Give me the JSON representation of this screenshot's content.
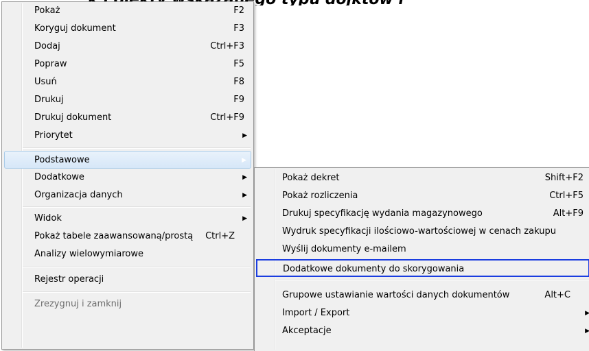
{
  "header_fragment": "k i ojekty wskazanego typu dojktow i",
  "main_menu": {
    "items": [
      {
        "label": "Pokaż",
        "shortcut": "F2"
      },
      {
        "label": "Koryguj dokument",
        "shortcut": "F3"
      },
      {
        "label": "Dodaj",
        "shortcut": "Ctrl+F3"
      },
      {
        "label": "Popraw",
        "shortcut": "F5"
      },
      {
        "label": "Usuń",
        "shortcut": "F8"
      },
      {
        "label": "Drukuj",
        "shortcut": "F9"
      },
      {
        "label": "Drukuj dokument",
        "shortcut": "Ctrl+F9"
      },
      {
        "label": "Priorytet",
        "shortcut": ""
      },
      {
        "label": "Podstawowe",
        "shortcut": ""
      },
      {
        "label": "Dodatkowe",
        "shortcut": ""
      },
      {
        "label": "Organizacja danych",
        "shortcut": ""
      },
      {
        "label": "Widok",
        "shortcut": ""
      },
      {
        "label": "Pokaż tabele zaawansowaną/prostą",
        "shortcut": "Ctrl+Z"
      },
      {
        "label": "Analizy wielowymiarowe",
        "shortcut": ""
      },
      {
        "label": "Rejestr operacji",
        "shortcut": ""
      },
      {
        "label": "Zrezygnuj i zamknij",
        "shortcut": ""
      }
    ],
    "submenu_arrow": "▶"
  },
  "sub_menu": {
    "items": [
      {
        "label": "Pokaż dekret",
        "shortcut": "Shift+F2"
      },
      {
        "label": "Pokaż rozliczenia",
        "shortcut": "Ctrl+F5"
      },
      {
        "label": "Drukuj specyfikację wydania magazynowego",
        "shortcut": "Alt+F9"
      },
      {
        "label": "Wydruk specyfikacji ilościowo-wartościowej w cenach zakupu",
        "shortcut": ""
      },
      {
        "label": "Wyślij dokumenty e-mailem",
        "shortcut": ""
      },
      {
        "label": "Dodatkowe dokumenty do skorygowania",
        "shortcut": ""
      },
      {
        "label": "Grupowe ustawianie wartości danych dokumentów",
        "shortcut": "Alt+C"
      },
      {
        "label": "Import / Export",
        "shortcut": ""
      },
      {
        "label": "Akceptacje",
        "shortcut": ""
      }
    ]
  }
}
